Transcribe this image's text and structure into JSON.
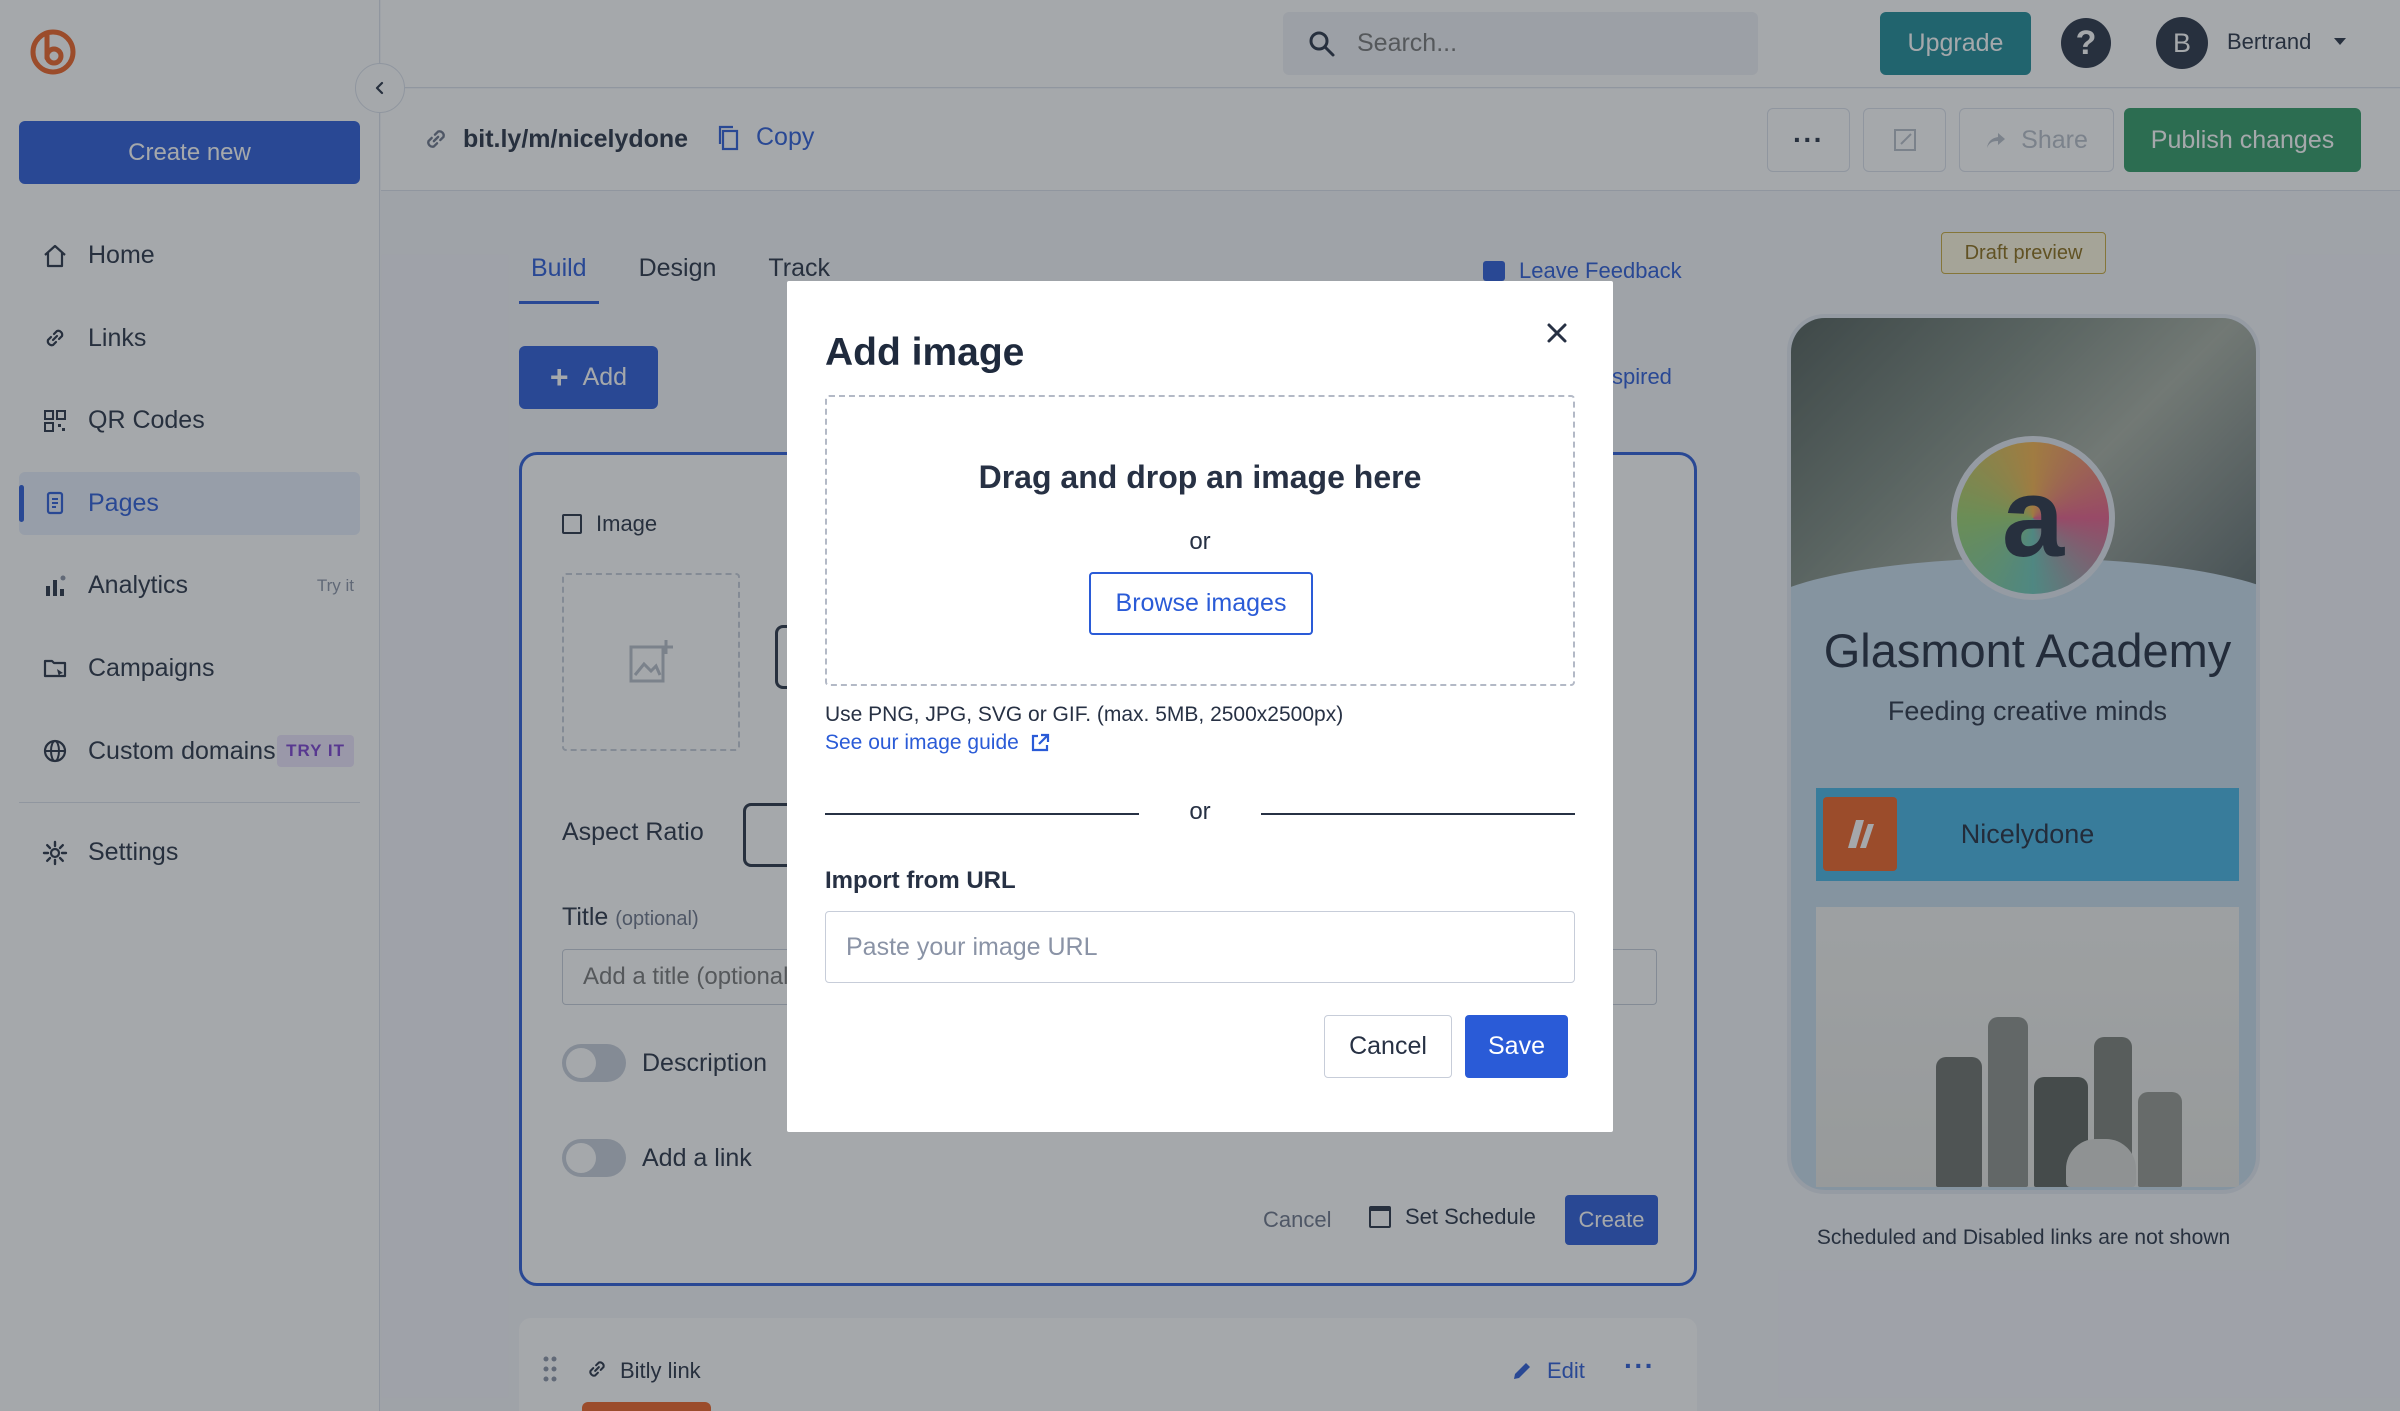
{
  "sidebar": {
    "create_new": "Create new",
    "items": [
      {
        "label": "Home",
        "icon": "home-icon"
      },
      {
        "label": "Links",
        "icon": "link-icon"
      },
      {
        "label": "QR Codes",
        "icon": "qr-code-icon"
      },
      {
        "label": "Pages",
        "icon": "page-icon",
        "active": true
      },
      {
        "label": "Analytics",
        "icon": "analytics-icon",
        "tag": "Try it"
      },
      {
        "label": "Campaigns",
        "icon": "campaign-icon"
      },
      {
        "label": "Custom domains",
        "icon": "globe-icon",
        "tag": "TRY IT"
      },
      {
        "label": "Settings",
        "icon": "gear-icon"
      }
    ]
  },
  "topbar": {
    "search_placeholder": "Search...",
    "upgrade": "Upgrade",
    "help": "?",
    "avatar_initial": "B",
    "username": "Bertrand"
  },
  "subbar": {
    "short_link": "bit.ly/m/nicelydone",
    "copy": "Copy",
    "more": "···",
    "share": "Share",
    "publish": "Publish changes"
  },
  "builder": {
    "tabs": [
      "Build",
      "Design",
      "Track"
    ],
    "active_tab": "Build",
    "leave_feedback": "Leave Feedback",
    "inspired_fragment": "spired",
    "add": "Add"
  },
  "editor": {
    "block_label": "Image",
    "aspect_ratio": "Aspect Ratio",
    "title_label": "Title",
    "title_optional": "(optional)",
    "title_placeholder": "Add a title (optional)",
    "description": "Description",
    "add_link": "Add a link",
    "cancel": "Cancel",
    "set_schedule": "Set Schedule",
    "create": "Create"
  },
  "link_card": {
    "label": "Bitly link",
    "edit": "Edit",
    "more": "···"
  },
  "preview": {
    "draft_label": "Draft preview",
    "avatar_glyph": "a",
    "name": "Glasmont Academy",
    "tagline": "Feeding creative minds",
    "link_label": "Nicelydone",
    "note": "Scheduled and Disabled links are not shown"
  },
  "modal": {
    "title": "Add image",
    "drop_title": "Drag and drop an image here",
    "or": "or",
    "browse": "Browse images",
    "hint": "Use PNG, JPG, SVG or GIF. (max. 5MB, 2500x2500px)",
    "guide": "See our image guide",
    "url_label": "Import from URL",
    "url_placeholder": "Paste your image URL",
    "url_value": "",
    "cancel": "Cancel",
    "save": "Save"
  },
  "colors": {
    "primary": "#2a5bd7",
    "publish": "#2f9a64",
    "upgrade": "#1c8a97",
    "preview_bg": "#c9dced",
    "preview_link": "#44b4e4",
    "brand_orange": "#ee6123"
  }
}
